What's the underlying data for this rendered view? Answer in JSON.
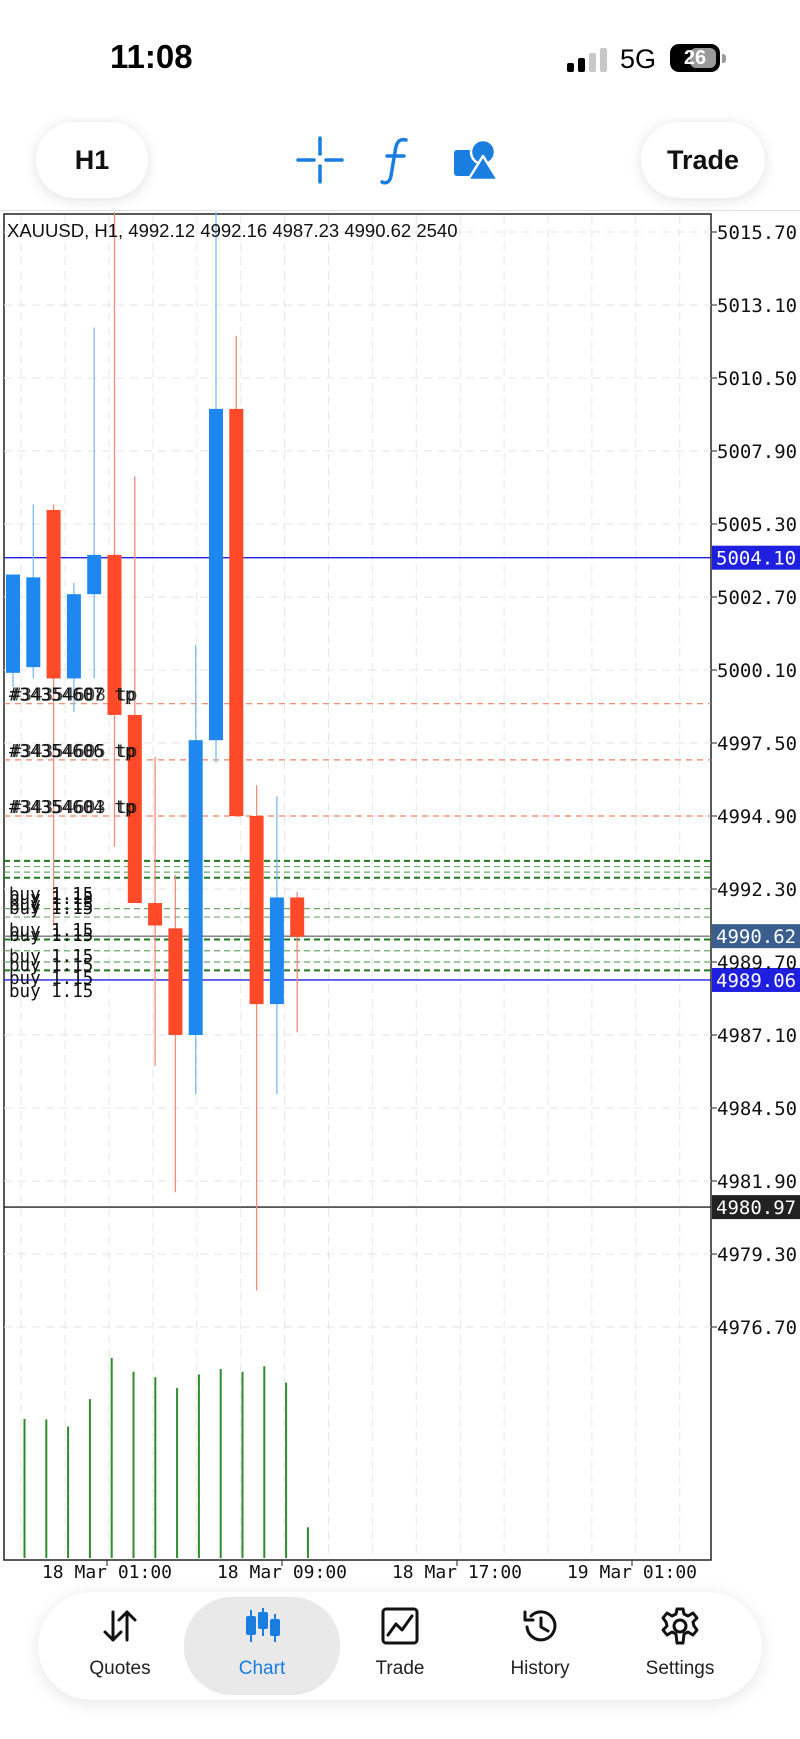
{
  "status_bar": {
    "time": "11:08",
    "network": "5G",
    "battery": "26"
  },
  "toolbar": {
    "timeframe_label": "H1",
    "trade_label": "Trade",
    "icons": [
      "crosshair-icon",
      "indicator-f-icon",
      "objects-icon"
    ]
  },
  "chart": {
    "header": "XAUUSD, H1, 4992.12 4992.16 4987.23 4990.62 2540",
    "price_axis_ticks": [
      "5015.70",
      "5013.10",
      "5010.50",
      "5007.90",
      "5005.30",
      "5002.70",
      "5000.10",
      "4997.50",
      "4994.90",
      "4992.30",
      "4989.70",
      "4987.10",
      "4984.50",
      "4981.90",
      "4979.30",
      "4976.70"
    ],
    "time_axis_ticks": [
      "18 Mar 01:00",
      "18 Mar 09:00",
      "18 Mar 17:00",
      "19 Mar 01:00"
    ],
    "price_labels": [
      {
        "text": "5004.10",
        "price": 5004.1,
        "bg": "#1f1fe0"
      },
      {
        "text": "4990.62",
        "price": 4990.62,
        "bg": "#3a5f8f"
      },
      {
        "text": "4989.06",
        "price": 4989.06,
        "bg": "#1f1fe0"
      },
      {
        "text": "4980.97",
        "price": 4980.97,
        "bg": "#222222"
      }
    ],
    "tp_labels": [
      {
        "text": "#34354607 tp",
        "overlay": "#34354608 tp",
        "price": 4998.9
      },
      {
        "text": "#34354606 tp",
        "overlay": "#34354605 tp",
        "price": 4996.9
      },
      {
        "text": "#34354604 tp",
        "overlay": "#34354603 tp",
        "price": 4994.9
      }
    ],
    "buy_labels": [
      "buy 1.15",
      "buy 1.15",
      "buy 1.15",
      "buy 1.15",
      "buy 1.15",
      "buy 1.15",
      "buy 1.15",
      "buy 1.15",
      "buy 1.15",
      "buy 1.15"
    ],
    "colors": {
      "bull": "#1e88f0",
      "bear": "#ff4a2a",
      "volume": "#2e8b2e",
      "order_line": "#1f7a1f",
      "tp_line": "#f08060",
      "grid": "#e6e6e6"
    },
    "chart_data": {
      "type": "candlestick",
      "symbol": "XAUUSD",
      "timeframe": "H1",
      "ylim": [
        4974.5,
        5017.0
      ],
      "candles": [
        {
          "o": 5000.0,
          "h": 5002.0,
          "l": 4999.5,
          "c": 5003.5
        },
        {
          "o": 5000.2,
          "h": 5006.0,
          "l": 4999.8,
          "c": 5003.4
        },
        {
          "o": 5005.8,
          "h": 5006.0,
          "l": 4991.0,
          "c": 4999.8
        },
        {
          "o": 4999.8,
          "h": 5003.2,
          "l": 4998.6,
          "c": 5002.8
        },
        {
          "o": 5002.8,
          "h": 5012.3,
          "l": 4999.8,
          "c": 5004.2
        },
        {
          "o": 5004.2,
          "h": 5016.5,
          "l": 4993.8,
          "c": 4998.5
        },
        {
          "o": 4998.5,
          "h": 5007.0,
          "l": 4993.0,
          "c": 4991.8
        },
        {
          "o": 4991.8,
          "h": 4997.0,
          "l": 4986.0,
          "c": 4991.0
        },
        {
          "o": 4990.9,
          "h": 4992.8,
          "l": 4981.5,
          "c": 4987.1
        },
        {
          "o": 4987.1,
          "h": 5001.0,
          "l": 4985.0,
          "c": 4997.6
        },
        {
          "o": 4997.6,
          "h": 5017.0,
          "l": 4996.8,
          "c": 5009.4
        },
        {
          "o": 5009.4,
          "h": 5012.0,
          "l": 4996.2,
          "c": 4994.9
        },
        {
          "o": 4994.9,
          "h": 4996.0,
          "l": 4978.0,
          "c": 4988.2
        },
        {
          "o": 4988.2,
          "h": 4995.6,
          "l": 4985.0,
          "c": 4992.0
        },
        {
          "o": 4992.0,
          "h": 4992.2,
          "l": 4987.2,
          "c": 4990.6
        }
      ],
      "volume": [
        2540,
        2530,
        2400,
        2900,
        3650,
        3400,
        3300,
        3100,
        3350,
        3450,
        3400,
        3500,
        3200,
        560
      ]
    }
  },
  "bottom_nav": {
    "items": [
      {
        "label": "Quotes",
        "icon": "quotes-arrows-icon"
      },
      {
        "label": "Chart",
        "icon": "candles-icon",
        "active": true
      },
      {
        "label": "Trade",
        "icon": "trade-chart-icon"
      },
      {
        "label": "History",
        "icon": "history-clock-icon"
      },
      {
        "label": "Settings",
        "icon": "gear-icon"
      }
    ]
  }
}
